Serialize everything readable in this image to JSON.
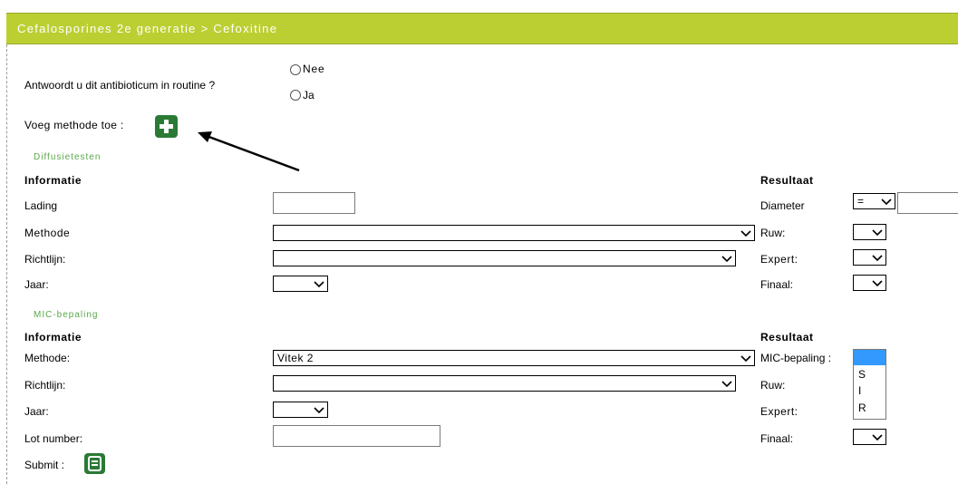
{
  "header": {
    "title": "Cefalosporines 2e generatie > Cefoxitine"
  },
  "routine": {
    "question": "Antwoordt u dit antibioticum in routine ?",
    "options": [
      "Nee",
      "Ja"
    ]
  },
  "add_method": {
    "label": "Voeg methode toe :",
    "icon": "plus-icon"
  },
  "diffusion": {
    "section_title": "Diffusietesten",
    "info_header": "Informatie",
    "result_header": "Resultaat",
    "fields": {
      "lading": "Lading",
      "methode": "Methode",
      "richtlijn": "Richtlijn:",
      "jaar": "Jaar:"
    },
    "results": {
      "diameter": "Diameter",
      "diameter_operator": "=",
      "ruw": "Ruw:",
      "expert": "Expert:",
      "finaal": "Finaal:"
    }
  },
  "mic": {
    "section_title": "MIC-bepaling",
    "info_header": "Informatie",
    "result_header": "Resultaat",
    "fields": {
      "methode": "Methode:",
      "methode_value": "Vitek 2",
      "richtlijn": "Richtlijn:",
      "jaar": "Jaar:",
      "lot_number": "Lot number:"
    },
    "results": {
      "mic_bepaling": "MIC-bepaling :",
      "mic_options": [
        "",
        "S",
        "I",
        "R"
      ],
      "ruw": "Ruw:",
      "expert": "Expert:",
      "finaal": "Finaal:"
    }
  },
  "submit": {
    "label": "Submit :",
    "icon": "save-list-icon"
  }
}
